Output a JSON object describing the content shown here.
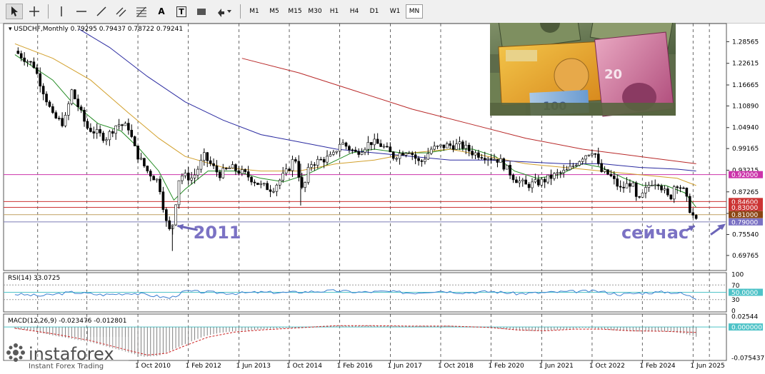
{
  "toolbar": {
    "tools": [
      {
        "icon": "cursor-arrow-icon"
      },
      {
        "icon": "crosshair-icon"
      },
      {
        "icon": "vertical-line-icon"
      },
      {
        "icon": "horizontal-line-icon"
      },
      {
        "icon": "trendline-icon"
      },
      {
        "icon": "channel-tool-icon"
      },
      {
        "icon": "fibonacci-icon"
      },
      {
        "icon": "text-tool-icon",
        "glyph": "A"
      },
      {
        "icon": "text-label-icon",
        "glyph": "T"
      },
      {
        "icon": "rectangle-tool-icon"
      },
      {
        "icon": "arrows-shapes-icon"
      }
    ],
    "timeframes": [
      "M1",
      "M5",
      "M15",
      "M30",
      "H1",
      "H4",
      "D1",
      "W1",
      "MN"
    ],
    "active_timeframe": "MN"
  },
  "chart_data": {
    "type": "candlestick",
    "symbol_label": "USDCHF,Monthly",
    "ohlc_text": "0.79295 0.79437 0.78722 0.79241",
    "price_axis": {
      "range": [
        0.67,
        1.31
      ],
      "ticks": [
        "1.28565",
        "1.22615",
        "1.16665",
        "1.10890",
        "1.04940",
        "0.99165",
        "0.93215",
        "0.87265",
        "0.81315",
        "0.75540",
        "0.69765"
      ]
    },
    "time_axis": {
      "labels": [
        "1 Oct 2010",
        "1 Feb 2012",
        "1 Jun 2013",
        "1 Oct 2014",
        "1 Feb 2016",
        "1 Jun 2017",
        "1 Oct 2018",
        "1 Feb 2020",
        "1 Jun 2021",
        "1 Oct 2022",
        "1 Feb 2024",
        "1 Jun 2025"
      ]
    },
    "price_series": [
      [
        2007.5,
        1.26
      ],
      [
        2008.0,
        1.22
      ],
      [
        2008.5,
        1.08
      ],
      [
        2008.8,
        1.06
      ],
      [
        2009.0,
        1.15
      ],
      [
        2009.4,
        1.05
      ],
      [
        2009.9,
        1.02
      ],
      [
        2010.2,
        1.06
      ],
      [
        2010.5,
        1.05
      ],
      [
        2010.7,
        0.98
      ],
      [
        2011.0,
        0.93
      ],
      [
        2011.3,
        0.9
      ],
      [
        2011.55,
        0.76
      ],
      [
        2011.66,
        0.78
      ],
      [
        2011.85,
        0.92
      ],
      [
        2012.2,
        0.91
      ],
      [
        2012.5,
        0.97
      ],
      [
        2012.9,
        0.92
      ],
      [
        2013.2,
        0.94
      ],
      [
        2013.6,
        0.92
      ],
      [
        2014.0,
        0.89
      ],
      [
        2014.3,
        0.88
      ],
      [
        2014.7,
        0.93
      ],
      [
        2014.9,
        0.97
      ],
      [
        2015.1,
        0.87
      ],
      [
        2015.3,
        0.95
      ],
      [
        2015.9,
        0.97
      ],
      [
        2016.1,
        1.01
      ],
      [
        2016.5,
        0.98
      ],
      [
        2016.9,
        1.01
      ],
      [
        2017.2,
        1.0
      ],
      [
        2017.5,
        0.97
      ],
      [
        2017.9,
        0.99
      ],
      [
        2018.2,
        0.95
      ],
      [
        2018.5,
        0.99
      ],
      [
        2018.9,
        1.0
      ],
      [
        2019.3,
        1.0
      ],
      [
        2019.6,
        0.98
      ],
      [
        2020.0,
        0.97
      ],
      [
        2020.3,
        0.96
      ],
      [
        2020.7,
        0.91
      ],
      [
        2021.0,
        0.89
      ],
      [
        2021.4,
        0.9
      ],
      [
        2021.8,
        0.92
      ],
      [
        2022.1,
        0.93
      ],
      [
        2022.5,
        0.97
      ],
      [
        2022.8,
        0.99
      ],
      [
        2022.95,
        0.93
      ],
      [
        2023.2,
        0.92
      ],
      [
        2023.5,
        0.88
      ],
      [
        2023.8,
        0.9
      ],
      [
        2023.95,
        0.84
      ],
      [
        2024.3,
        0.9
      ],
      [
        2024.5,
        0.9
      ],
      [
        2024.8,
        0.85
      ],
      [
        2024.95,
        0.9
      ],
      [
        2025.15,
        0.88
      ],
      [
        2025.35,
        0.82
      ],
      [
        2025.5,
        0.79
      ]
    ],
    "moving_averages": [
      {
        "color": "#228b22",
        "points": [
          [
            2007.5,
            1.25
          ],
          [
            2008.5,
            1.18
          ],
          [
            2009.0,
            1.12
          ],
          [
            2009.7,
            1.06
          ],
          [
            2010.3,
            1.04
          ],
          [
            2010.8,
            0.99
          ],
          [
            2011.3,
            0.93
          ],
          [
            2011.7,
            0.85
          ],
          [
            2012.0,
            0.88
          ],
          [
            2012.6,
            0.93
          ],
          [
            2013.3,
            0.93
          ],
          [
            2014.0,
            0.91
          ],
          [
            2014.6,
            0.9
          ],
          [
            2015.2,
            0.92
          ],
          [
            2015.8,
            0.95
          ],
          [
            2016.4,
            0.98
          ],
          [
            2017.0,
            0.99
          ],
          [
            2017.7,
            0.98
          ],
          [
            2018.4,
            0.98
          ],
          [
            2019.0,
            0.99
          ],
          [
            2019.6,
            0.99
          ],
          [
            2020.2,
            0.97
          ],
          [
            2020.7,
            0.93
          ],
          [
            2021.3,
            0.91
          ],
          [
            2021.9,
            0.92
          ],
          [
            2022.5,
            0.95
          ],
          [
            2023.0,
            0.94
          ],
          [
            2023.6,
            0.91
          ],
          [
            2024.1,
            0.89
          ],
          [
            2024.7,
            0.89
          ],
          [
            2025.2,
            0.87
          ],
          [
            2025.5,
            0.83
          ]
        ]
      },
      {
        "color": "#d2a02c",
        "points": [
          [
            2007.5,
            1.28
          ],
          [
            2008.5,
            1.24
          ],
          [
            2009.5,
            1.18
          ],
          [
            2010.5,
            1.09
          ],
          [
            2011.3,
            1.02
          ],
          [
            2012.0,
            0.97
          ],
          [
            2013.0,
            0.94
          ],
          [
            2014.0,
            0.93
          ],
          [
            2015.0,
            0.93
          ],
          [
            2016.0,
            0.95
          ],
          [
            2017.0,
            0.96
          ],
          [
            2018.0,
            0.98
          ],
          [
            2019.0,
            0.99
          ],
          [
            2020.0,
            0.97
          ],
          [
            2021.0,
            0.95
          ],
          [
            2022.0,
            0.94
          ],
          [
            2023.0,
            0.93
          ],
          [
            2024.0,
            0.92
          ],
          [
            2025.0,
            0.91
          ],
          [
            2025.5,
            0.89
          ]
        ]
      },
      {
        "color": "#2a2aa0",
        "points": [
          [
            2009.2,
            1.32
          ],
          [
            2010.0,
            1.27
          ],
          [
            2011.0,
            1.19
          ],
          [
            2012.0,
            1.12
          ],
          [
            2013.0,
            1.07
          ],
          [
            2014.0,
            1.03
          ],
          [
            2015.0,
            1.01
          ],
          [
            2016.0,
            0.99
          ],
          [
            2017.0,
            0.98
          ],
          [
            2018.0,
            0.97
          ],
          [
            2019.0,
            0.96
          ],
          [
            2020.0,
            0.96
          ],
          [
            2021.0,
            0.955
          ],
          [
            2022.0,
            0.95
          ],
          [
            2023.0,
            0.95
          ],
          [
            2024.0,
            0.94
          ],
          [
            2025.0,
            0.935
          ],
          [
            2025.5,
            0.93
          ]
        ]
      },
      {
        "color": "#b82828",
        "points": [
          [
            2013.5,
            1.24
          ],
          [
            2015.0,
            1.2
          ],
          [
            2016.5,
            1.15
          ],
          [
            2018.0,
            1.1
          ],
          [
            2019.5,
            1.06
          ],
          [
            2021.0,
            1.02
          ],
          [
            2022.5,
            0.99
          ],
          [
            2024.0,
            0.97
          ],
          [
            2025.5,
            0.95
          ]
        ]
      }
    ],
    "horizontal_levels": [
      {
        "value": 0.92,
        "label": "0.92000",
        "color": "#cc33aa",
        "label_bg": "#cc33aa"
      },
      {
        "value": 0.846,
        "label": "0.84600",
        "color": "#cc3333",
        "label_bg": "#cc3333"
      },
      {
        "value": 0.83,
        "label": "0.83000",
        "color": "#cc3333",
        "label_bg": "#cc3333"
      },
      {
        "value": 0.81,
        "label": "0.81000",
        "color": "#c0a060",
        "label_bg": "#8b4513"
      },
      {
        "value": 0.79,
        "label": "0.79000",
        "color": "#7a7ab4",
        "label_bg": "#7b72c4"
      }
    ],
    "annotations": [
      {
        "text": "2011",
        "at": [
          2011.95,
          0.756
        ],
        "arrow_to": [
          2011.7,
          0.785
        ]
      },
      {
        "text": "сейчас",
        "at": [
          2023.6,
          0.756
        ],
        "arrow_to": [
          2025.5,
          0.785
        ]
      }
    ],
    "rsi": {
      "label": "RSI(14) 33.0725",
      "scale": [
        "100",
        "70",
        "50.0000",
        "30",
        "0"
      ],
      "levels": [
        70,
        50,
        30
      ],
      "values": [
        [
          2007.5,
          45
        ],
        [
          2008.2,
          40
        ],
        [
          2009.0,
          50
        ],
        [
          2009.8,
          43
        ],
        [
          2010.6,
          48
        ],
        [
          2011.2,
          40
        ],
        [
          2011.6,
          34
        ],
        [
          2012.0,
          53
        ],
        [
          2012.6,
          50
        ],
        [
          2013.3,
          47
        ],
        [
          2014.0,
          50
        ],
        [
          2014.7,
          49
        ],
        [
          2015.3,
          52
        ],
        [
          2016.0,
          54
        ],
        [
          2016.6,
          50
        ],
        [
          2017.3,
          52
        ],
        [
          2018.0,
          48
        ],
        [
          2018.7,
          54
        ],
        [
          2019.4,
          49
        ],
        [
          2020.1,
          52
        ],
        [
          2020.8,
          46
        ],
        [
          2021.5,
          49
        ],
        [
          2022.2,
          52
        ],
        [
          2022.9,
          53
        ],
        [
          2023.5,
          44
        ],
        [
          2024.1,
          48
        ],
        [
          2024.7,
          51
        ],
        [
          2025.1,
          47
        ],
        [
          2025.5,
          33
        ]
      ]
    },
    "macd": {
      "label": "MACD(12,26,9) -0.023476 -0.012801",
      "scale": [
        "0.02544",
        "0.000000",
        "-0.075437"
      ],
      "range": [
        -0.0754,
        0.0254
      ],
      "histogram": [
        [
          2007.5,
          -0.004
        ],
        [
          2008.0,
          -0.01
        ],
        [
          2008.5,
          -0.02
        ],
        [
          2009.0,
          -0.028
        ],
        [
          2009.5,
          -0.036
        ],
        [
          2010.0,
          -0.048
        ],
        [
          2010.5,
          -0.06
        ],
        [
          2010.9,
          -0.07
        ],
        [
          2011.3,
          -0.068
        ],
        [
          2011.7,
          -0.052
        ],
        [
          2012.1,
          -0.036
        ],
        [
          2012.5,
          -0.022
        ],
        [
          2012.9,
          -0.014
        ],
        [
          2013.3,
          -0.01
        ],
        [
          2013.7,
          -0.008
        ],
        [
          2014.1,
          -0.005
        ],
        [
          2014.5,
          -0.003
        ],
        [
          2014.9,
          -0.002
        ],
        [
          2015.3,
          0.001
        ],
        [
          2015.7,
          0.003
        ],
        [
          2016.1,
          0.004
        ],
        [
          2016.5,
          0.003
        ],
        [
          2016.9,
          0.004
        ],
        [
          2017.3,
          0.003
        ],
        [
          2017.7,
          0.002
        ],
        [
          2018.1,
          0.002
        ],
        [
          2018.5,
          0.003
        ],
        [
          2018.9,
          0.003
        ],
        [
          2019.3,
          0.002
        ],
        [
          2019.7,
          0.001
        ],
        [
          2020.1,
          -0.002
        ],
        [
          2020.5,
          -0.006
        ],
        [
          2020.9,
          -0.009
        ],
        [
          2021.3,
          -0.01
        ],
        [
          2021.7,
          -0.008
        ],
        [
          2022.1,
          -0.005
        ],
        [
          2022.5,
          -0.002
        ],
        [
          2022.9,
          -0.004
        ],
        [
          2023.3,
          -0.008
        ],
        [
          2023.7,
          -0.01
        ],
        [
          2024.1,
          -0.011
        ],
        [
          2024.5,
          -0.01
        ],
        [
          2024.9,
          -0.012
        ],
        [
          2025.2,
          -0.016
        ],
        [
          2025.5,
          -0.023
        ]
      ],
      "signal": [
        [
          2007.5,
          -0.003
        ],
        [
          2008.5,
          -0.016
        ],
        [
          2009.5,
          -0.032
        ],
        [
          2010.5,
          -0.055
        ],
        [
          2011.0,
          -0.066
        ],
        [
          2011.5,
          -0.062
        ],
        [
          2012.0,
          -0.044
        ],
        [
          2012.6,
          -0.024
        ],
        [
          2013.3,
          -0.012
        ],
        [
          2014.0,
          -0.007
        ],
        [
          2015.0,
          -0.002
        ],
        [
          2016.0,
          0.003
        ],
        [
          2017.0,
          0.003
        ],
        [
          2018.0,
          0.002
        ],
        [
          2019.0,
          0.002
        ],
        [
          2020.0,
          -0.001
        ],
        [
          2020.8,
          -0.007
        ],
        [
          2021.5,
          -0.009
        ],
        [
          2022.3,
          -0.005
        ],
        [
          2023.0,
          -0.005
        ],
        [
          2023.8,
          -0.009
        ],
        [
          2024.6,
          -0.01
        ],
        [
          2025.5,
          -0.0128
        ]
      ]
    }
  },
  "inset_image": {
    "description_icon": "banknotes-photo-icon"
  },
  "watermark": {
    "brand": "instaforex",
    "tagline": "Instant Forex Trading"
  }
}
